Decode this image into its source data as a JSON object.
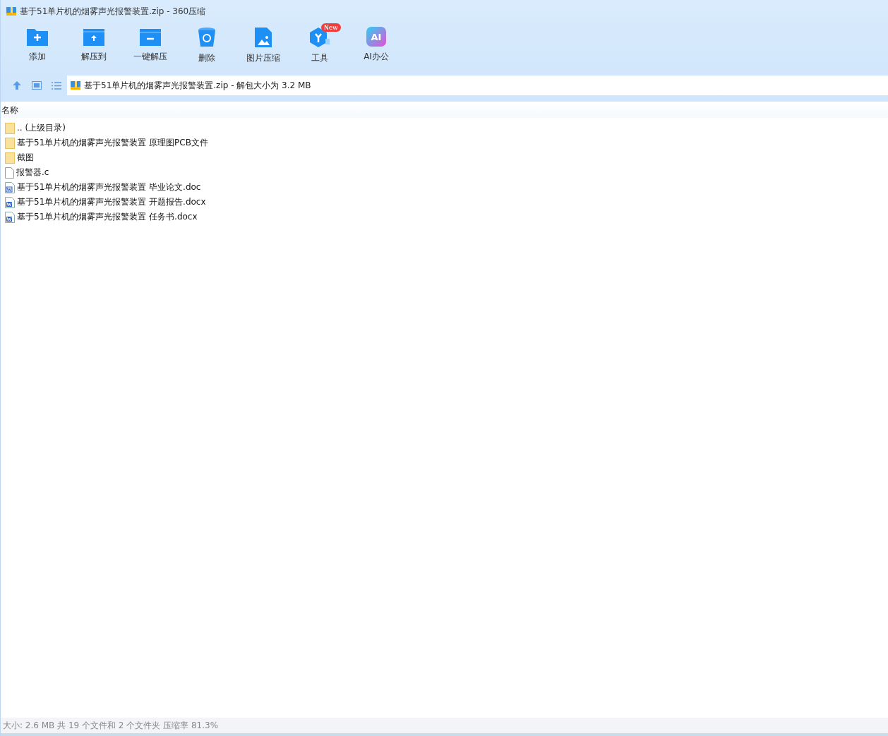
{
  "window": {
    "title": "基于51单片机的烟雾声光报警装置.zip - 360压缩"
  },
  "toolbar": [
    {
      "kind": "add",
      "label": "添加"
    },
    {
      "kind": "extract",
      "label": "解压到"
    },
    {
      "kind": "oneclick",
      "label": "一键解压"
    },
    {
      "kind": "delete",
      "label": "删除"
    },
    {
      "kind": "image",
      "label": "图片压缩"
    },
    {
      "kind": "tools",
      "label": "工具",
      "badge": "New"
    },
    {
      "kind": "ai",
      "label": "AI办公",
      "icon_text": "AI"
    }
  ],
  "address": {
    "path": "基于51单片机的烟雾声光报警装置.zip - 解包大小为 3.2 MB"
  },
  "table": {
    "columns": [
      "名称"
    ],
    "rows": [
      {
        "kind": "folder",
        "name": ".. (上级目录)"
      },
      {
        "kind": "folder",
        "name": "基于51单片机的烟雾声光报警装置 原理图PCB文件"
      },
      {
        "kind": "folder",
        "name": "截图"
      },
      {
        "kind": "file",
        "name": "报警器.c"
      },
      {
        "kind": "doc",
        "name": "基于51单片机的烟雾声光报警装置 毕业论文.doc"
      },
      {
        "kind": "docx",
        "name": "基于51单片机的烟雾声光报警装置 开题报告.docx"
      },
      {
        "kind": "docx",
        "name": "基于51单片机的烟雾声光报警装置 任务书.docx"
      }
    ]
  },
  "status_bar": "大小: 2.6 MB 共 19 个文件和 2 个文件夹 压缩率 81.3%"
}
